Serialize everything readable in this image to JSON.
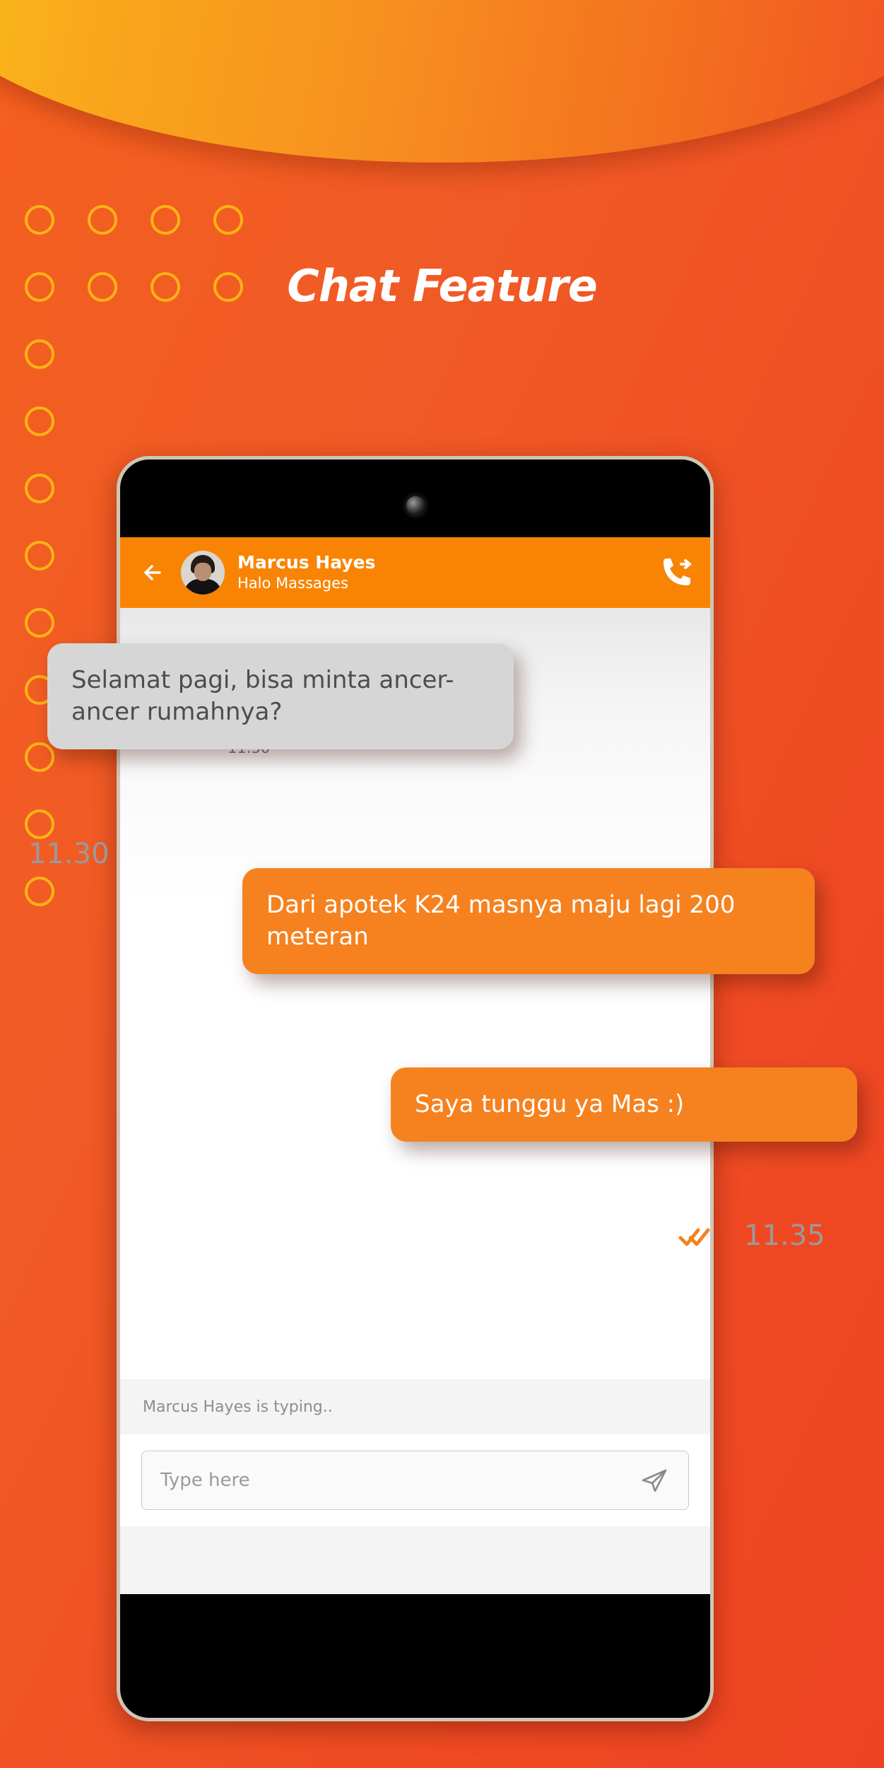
{
  "hero": {
    "title": "Chat Feature",
    "gradient_from": "#F8C21A",
    "gradient_to": "#EF4B23"
  },
  "background": {
    "color": "#F15A29",
    "ring_color": "#FBB316",
    "ring_count": 24
  },
  "phone": {
    "bezel_color": "#cfc6b6",
    "body_color": "#000000",
    "camera_icon": "front-camera-dot"
  },
  "appbar": {
    "background": "#F98404",
    "back_icon": "back-arrow-icon",
    "avatar_alt": "avatar",
    "contact_name": "Marcus Hayes",
    "contact_subtitle": "Halo Massages",
    "call_icon": "call-forward-icon"
  },
  "messages": [
    {
      "id": "m1",
      "text": "Selamat pagi, bisa minta ancer-ancer rumahnya?",
      "side": "incoming",
      "bubble_color": "#D6D6D6",
      "text_color": "#4d4d4d",
      "time": "11.30"
    },
    {
      "id": "m2",
      "text": "Dari apotek K24 masnya maju lagi 200 meteran",
      "side": "outgoing",
      "bubble_color": "#F5821F",
      "text_color": "#FFFFFF"
    },
    {
      "id": "m3",
      "text": "Saya tunggu ya Mas :)",
      "side": "outgoing",
      "bubble_color": "#F5821F",
      "text_color": "#FFFFFF",
      "time": "11.35",
      "status_icon": "double-check-icon",
      "status_color": "#F5821F"
    }
  ],
  "timestamps": {
    "inside_first": "11.30",
    "outside_first": "11.30",
    "outside_last": "11.35"
  },
  "typing": {
    "text": "Marcus Hayes is typing.."
  },
  "composer": {
    "placeholder": "Type here",
    "value": "",
    "send_icon": "send-paper-plane-icon"
  }
}
